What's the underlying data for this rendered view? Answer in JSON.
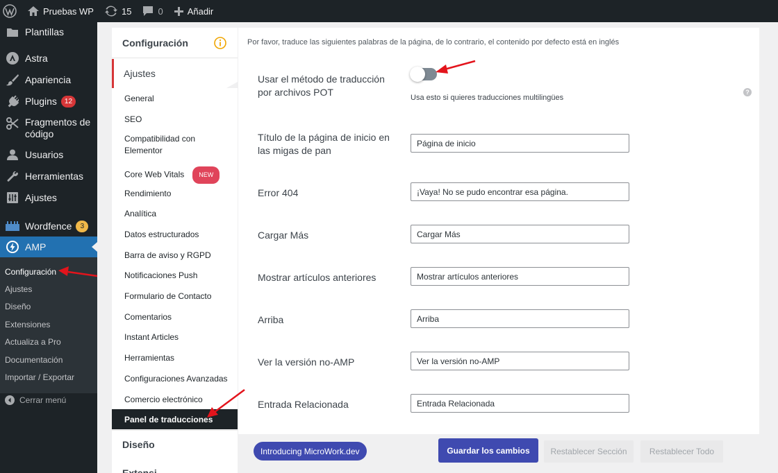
{
  "admin_bar": {
    "site_name": "Pruebas WP",
    "updates_count": "15",
    "comments_count": "0",
    "new_label": "Añadir"
  },
  "sidebar": {
    "items": [
      {
        "label": "Plantillas",
        "icon": "templates-icon"
      },
      {
        "label": "Astra",
        "icon": "astra-icon"
      },
      {
        "label": "Apariencia",
        "icon": "paintbrush-icon"
      },
      {
        "label": "Plugins",
        "icon": "plugin-icon",
        "badge": "12"
      },
      {
        "label": "Fragmentos de código",
        "icon": "scissors-icon"
      },
      {
        "label": "Usuarios",
        "icon": "users-icon"
      },
      {
        "label": "Herramientas",
        "icon": "wrench-icon"
      },
      {
        "label": "Ajustes",
        "icon": "settings-icon"
      },
      {
        "label": "Wordfence",
        "icon": "wordfence-icon",
        "badge": "3"
      },
      {
        "label": "AMP",
        "icon": "amp-icon"
      }
    ],
    "amp_submenu": [
      "Configuración",
      "Ajustes",
      "Diseño",
      "Extensiones",
      "Actualiza a Pro",
      "Documentación",
      "Importar / Exportar"
    ],
    "collapse_label": "Cerrar menú"
  },
  "settings_nav": {
    "config_label": "Configuración",
    "ajustes_label": "Ajustes",
    "links": [
      "General",
      "SEO",
      "Compatibilidad con Elementor",
      "Core Web Vitals",
      "Rendimiento",
      "Analítica",
      "Datos estructurados",
      "Barra de aviso y RGPD",
      "Notificaciones Push",
      "Formulario de Contacto",
      "Comentarios",
      "Instant Articles",
      "Herramientas",
      "Configuraciones Avanzadas",
      "Comercio electrónico"
    ],
    "new_badge": "NEW",
    "active_link": "Panel de traducciones",
    "diseno_label": "Diseño",
    "next_label": "Extensi"
  },
  "content": {
    "notice": "Por favor, traduce las siguientes palabras de la página, de lo contrario, el contenido por defecto está en inglés",
    "pot": {
      "label": "Usar el método de traducción por archivos POT",
      "help": "Usa esto si quieres traducciones multilingües",
      "enabled": false
    },
    "fields": [
      {
        "label": "Título de la página de inicio en las migas de pan",
        "value": "Página de inicio"
      },
      {
        "label": "Error 404",
        "value": "¡Vaya! No se pudo encontrar esa página."
      },
      {
        "label": "Cargar Más",
        "value": "Cargar Más"
      },
      {
        "label": "Mostrar artículos anteriores",
        "value": "Mostrar artículos anteriores"
      },
      {
        "label": "Arriba",
        "value": "Arriba"
      },
      {
        "label": "Ver la versión no-AMP",
        "value": "Ver la versión no-AMP"
      },
      {
        "label": "Entrada Relacionada",
        "value": "Entrada Relacionada"
      }
    ]
  },
  "footer": {
    "intro_label": "Introducing MicroWork.dev",
    "save_label": "Guardar los cambios",
    "reset_section_label": "Restablecer Sección",
    "reset_all_label": "Restablecer Todo"
  },
  "colors": {
    "admin_bg": "#1d2327",
    "accent_blue": "#2271b1",
    "button_blue": "#3f4ab0",
    "badge_red": "#d63638",
    "arrow_red": "#e3141c"
  }
}
